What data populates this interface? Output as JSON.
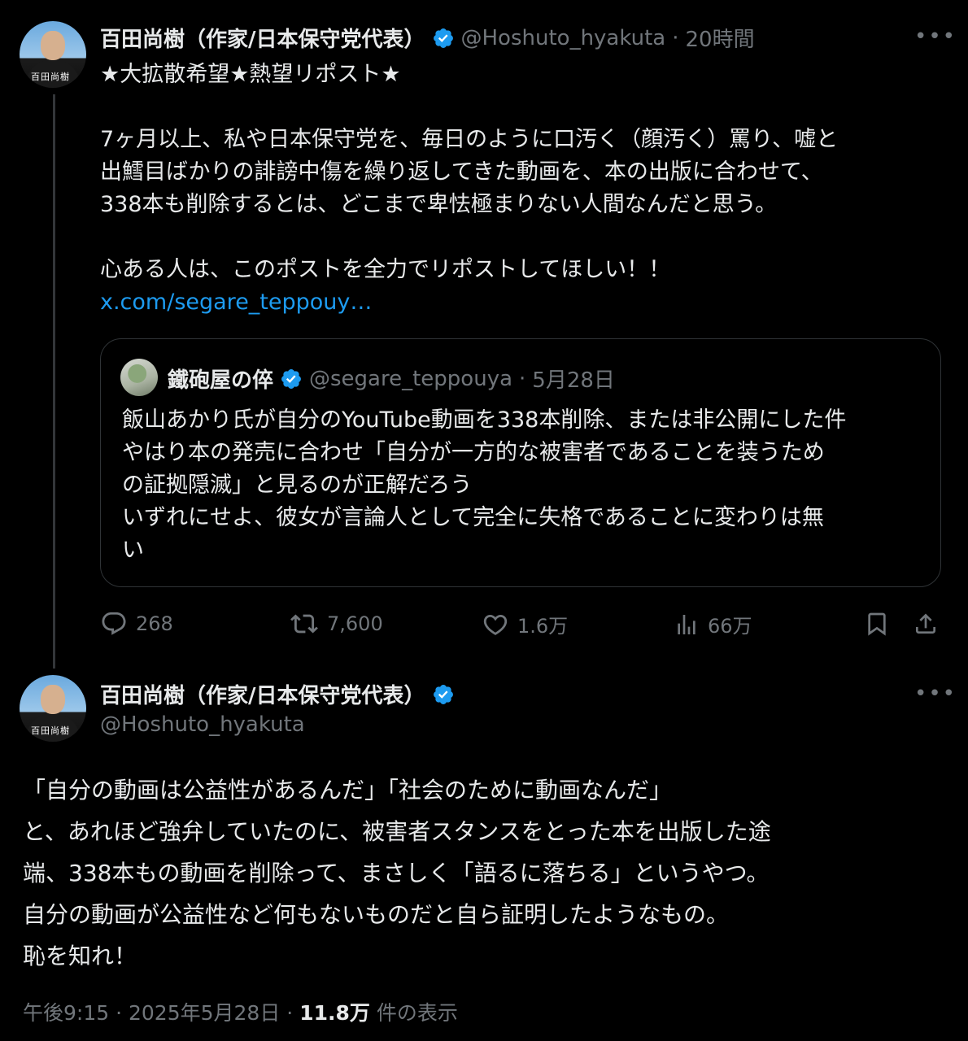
{
  "tweet1": {
    "author_name": "百田尚樹（作家/日本保守党代表）",
    "handle": "@Hoshuto_hyakuta",
    "time": "20時間",
    "separator": "·",
    "avatar_sign": "百田尚樹",
    "text_line1": "★大拡散希望★熱望リポスト★",
    "text_para2": "7ヶ月以上、私や日本保守党を、毎日のように口汚く（顔汚く）罵り、嘘と\n出鱈目ばかりの誹謗中傷を繰り返してきた動画を、本の出版に合わせて、\n338本も削除するとは、どこまで卑怯極まりない人間なんだと思う。",
    "text_para3": "心ある人は、このポストを全力でリポストしてほしい！！",
    "link": "x.com/segare_teppouy…",
    "quote": {
      "author_name": "鐵砲屋の倅",
      "handle": "@segare_teppouya",
      "date": "5月28日",
      "text": "飯山あかり氏が自分のYouTube動画を338本削除、または非公開にした件\nやはり本の発売に合わせ「自分が一方的な被害者であることを装うため\nの証拠隠滅」と見るのが正解だろう\nいずれにせよ、彼女が言論人として完全に失格であることに変わりは無\nい"
    },
    "actions": {
      "replies": "268",
      "reposts": "7,600",
      "likes": "1.6万",
      "views": "66万"
    }
  },
  "tweet2": {
    "author_name": "百田尚樹（作家/日本保守党代表）",
    "handle": "@Hoshuto_hyakuta",
    "avatar_sign": "百田尚樹",
    "text": "「自分の動画は公益性があるんだ」「社会のために動画なんだ」\nと、あれほど強弁していたのに、被害者スタンスをとった本を出版した途\n端、338本もの動画を削除って、まさしく「語るに落ちる」というやつ。\n自分の動画が公益性など何もないものだと自ら証明したようなもの。\n恥を知れ！",
    "meta": {
      "time": "午後9:15",
      "date": "2025年5月28日",
      "views_count": "11.8万",
      "views_label": "件の表示",
      "sep": "·"
    }
  },
  "colors": {
    "background": "#000000",
    "text": "#e7e9ea",
    "muted": "#71767b",
    "link": "#1d9bf0",
    "verified": "#1d9bf0",
    "border": "#2f3336"
  },
  "icons": [
    "verified-badge-icon",
    "more-icon",
    "reply-icon",
    "repost-icon",
    "like-icon",
    "views-icon",
    "bookmark-icon",
    "share-icon"
  ]
}
